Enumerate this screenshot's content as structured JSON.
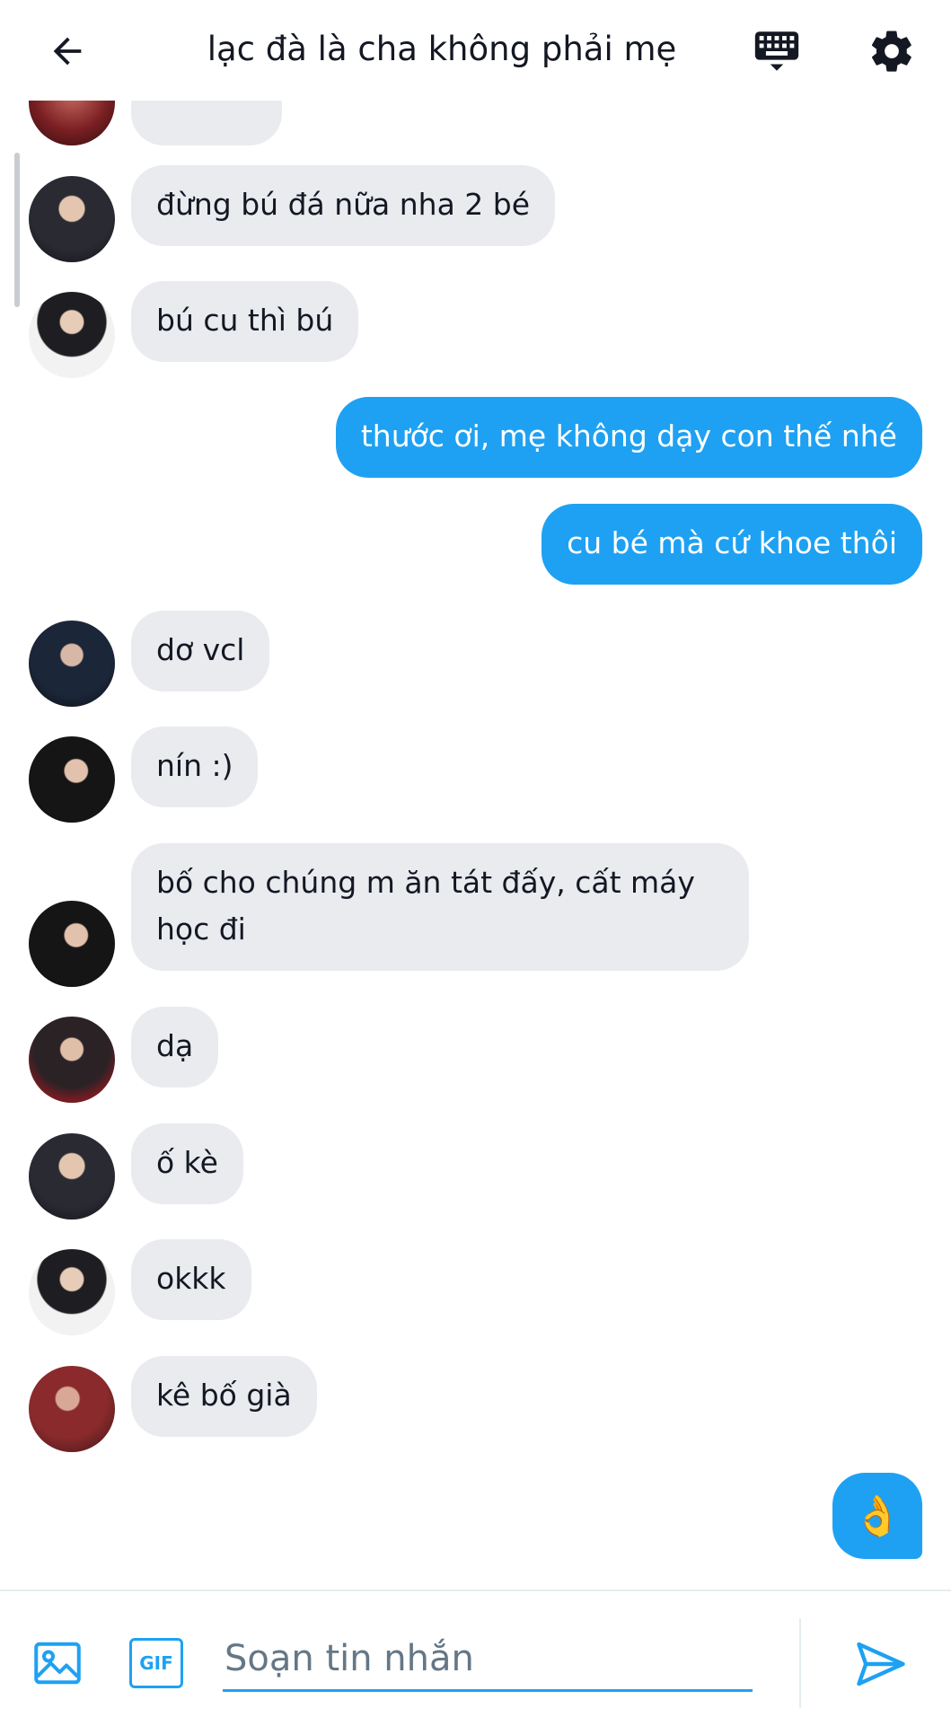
{
  "header": {
    "title": "lạc đà là cha không phải mẹ",
    "back_icon": "arrow-left-icon",
    "keyboard_icon": "keyboard-icon",
    "settings_icon": "gear-icon"
  },
  "messages": [
    {
      "dir": "in",
      "text": "đừng bú đá nữa nha 2 bé",
      "avatar": "avatar-1"
    },
    {
      "dir": "in",
      "text": "bú cu thì bú",
      "avatar": "avatar-2"
    },
    {
      "dir": "out",
      "text": "thước ơi, mẹ không dạy con thế nhé"
    },
    {
      "dir": "out",
      "text": "cu bé mà cứ khoe thôi"
    },
    {
      "dir": "in",
      "text": "dơ vcl",
      "avatar": "avatar-3"
    },
    {
      "dir": "in",
      "text": "nín :)",
      "avatar": "avatar-4"
    },
    {
      "dir": "in",
      "text": "bố cho chúng m ăn tát đấy, cất máy học đi",
      "avatar": "avatar-4"
    },
    {
      "dir": "in",
      "text": "dạ",
      "avatar": "avatar-5"
    },
    {
      "dir": "in",
      "text": "ố kè",
      "avatar": "avatar-1"
    },
    {
      "dir": "in",
      "text": "okkk",
      "avatar": "avatar-2"
    },
    {
      "dir": "in",
      "text": "kê bố già",
      "avatar": "avatar-6"
    },
    {
      "dir": "out",
      "text": "👌",
      "emoji": true
    }
  ],
  "composer": {
    "placeholder": "Soạn tin nhắn",
    "gif_label": "GIF",
    "image_icon": "image-icon",
    "send_icon": "send-icon"
  },
  "colors": {
    "accent": "#1ea1f2",
    "incoming_bubble": "#e9ebef",
    "text": "#141823"
  }
}
